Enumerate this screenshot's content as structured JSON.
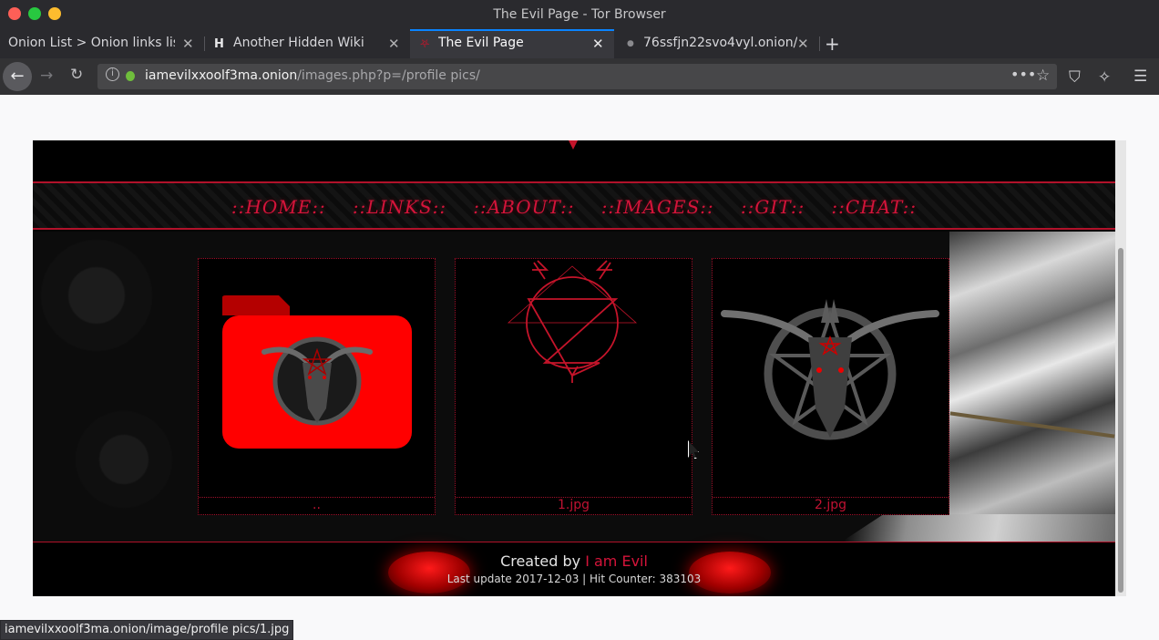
{
  "window": {
    "title": "The Evil Page - Tor Browser"
  },
  "tabs": [
    {
      "label": "Onion List > Onion links list f",
      "icon": "",
      "active": false
    },
    {
      "label": "Another Hidden Wiki",
      "icon": "H",
      "active": false
    },
    {
      "label": "The Evil Page",
      "icon": "evil-site-icon",
      "active": true
    },
    {
      "label": "76ssfjn22svo4vyl.onion/",
      "icon": "dot-icon",
      "active": false
    }
  ],
  "url": {
    "host": "iamevilxxoolf3ma.onion",
    "path": "/images.php?p=/profile pics/"
  },
  "page": {
    "nav": [
      "::HOME::",
      "::LINKS::",
      "::ABOUT::",
      "::IMAGES::",
      "::GIT::",
      "::CHAT::"
    ],
    "gallery": [
      {
        "caption": "..",
        "thumb": "folder-goat-icon"
      },
      {
        "caption": "1.jpg",
        "thumb": "pentagram-icon"
      },
      {
        "caption": "2.jpg",
        "thumb": "baphomet-icon"
      }
    ],
    "footer": {
      "created_by": "Created by",
      "author": "I am Evil",
      "meta": "Last update 2017-12-03 | Hit Counter: 383103"
    }
  },
  "status_url": "iamevilxxoolf3ma.onion/image/profile pics/1.jpg",
  "colors": {
    "accent": "#d4143a",
    "tab_highlight": "#0a84ff",
    "chrome": "#2a2a2e"
  }
}
